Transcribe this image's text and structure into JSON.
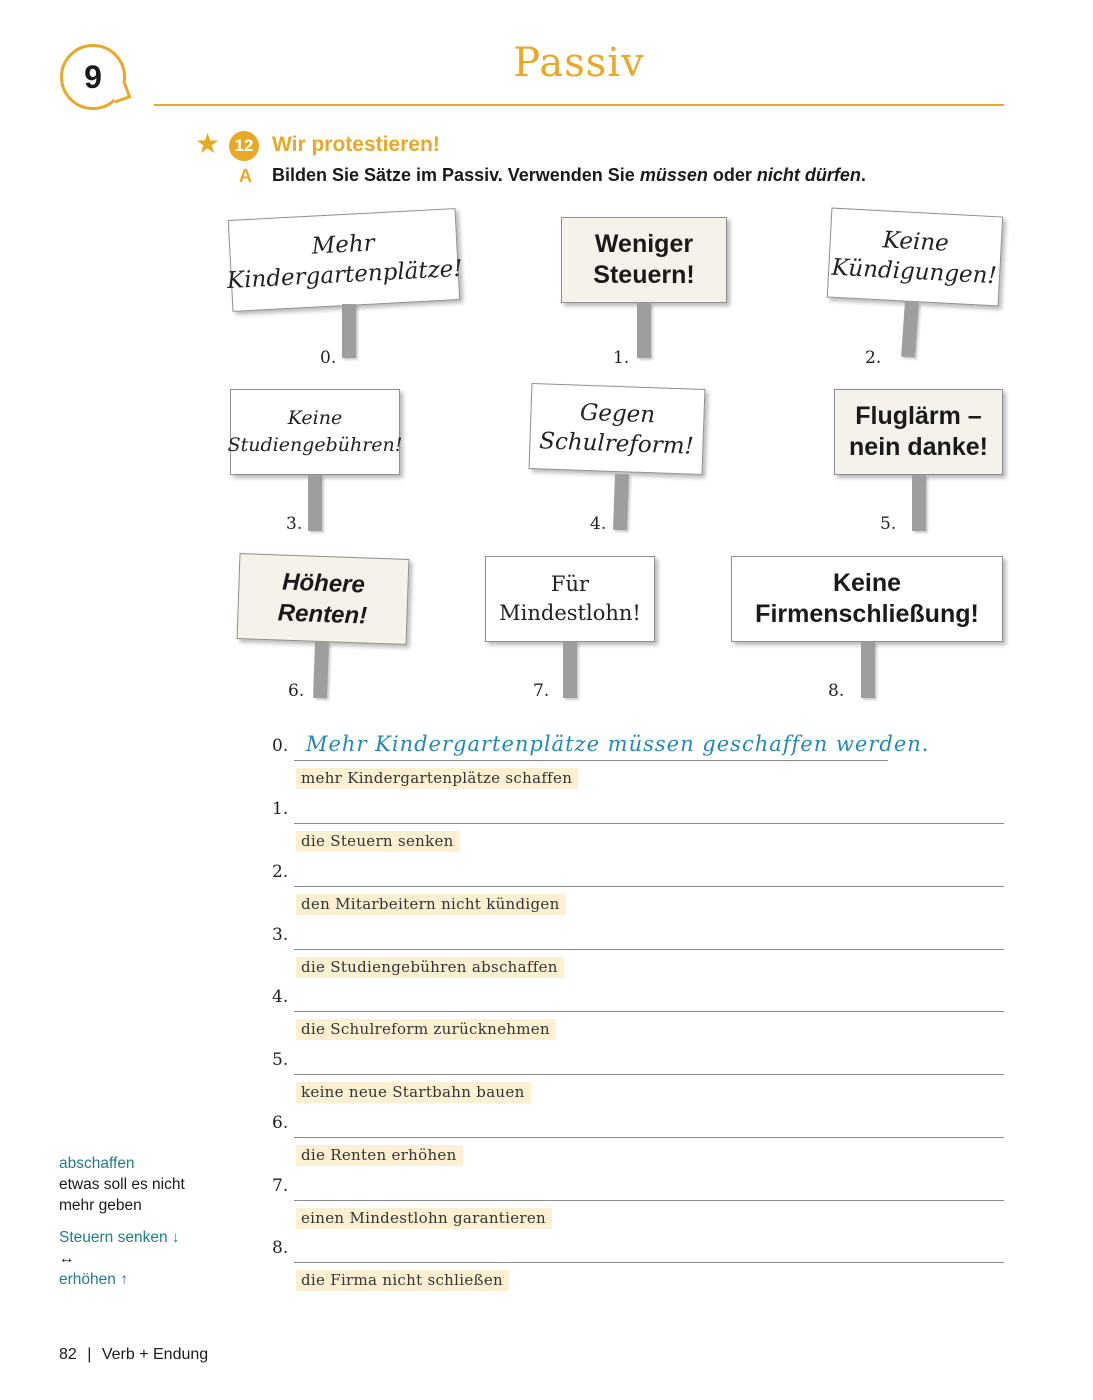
{
  "header": {
    "chapter_number": "9",
    "title": "Passiv"
  },
  "exercise": {
    "number": "12",
    "title": "Wir protestieren!",
    "task_letter": "A",
    "instruction_start": "Bilden Sie Sätze im Passiv. Verwenden Sie ",
    "instruction_em1": "müssen",
    "instruction_mid": " oder ",
    "instruction_em2": "nicht dürfen",
    "instruction_end": "."
  },
  "signs": [
    {
      "number": "0.",
      "line1": "Mehr",
      "line2": "Kindergartenplätze!"
    },
    {
      "number": "1.",
      "line1": "Weniger",
      "line2": "Steuern!"
    },
    {
      "number": "2.",
      "line1": "Keine",
      "line2": "Kündigungen!"
    },
    {
      "number": "3.",
      "line1": "Keine",
      "line2": "Studiengebühren!"
    },
    {
      "number": "4.",
      "line1": "Gegen",
      "line2": "Schulreform!"
    },
    {
      "number": "5.",
      "line1": "Fluglärm –",
      "line2": "nein danke!"
    },
    {
      "number": "6.",
      "line1": "Höhere",
      "line2": "Renten!"
    },
    {
      "number": "7.",
      "line1": "Für",
      "line2": "Mindestlohn!"
    },
    {
      "number": "8.",
      "line1": "Keine",
      "line2": "Firmenschließung!"
    }
  ],
  "answers": [
    {
      "number": "0.",
      "answer": "Mehr Kindergartenplätze müssen geschaffen werden.",
      "hint": "mehr Kindergartenplätze schaffen"
    },
    {
      "number": "1.",
      "answer": "",
      "hint": "die Steuern senken"
    },
    {
      "number": "2.",
      "answer": "",
      "hint": "den Mitarbeitern nicht kündigen"
    },
    {
      "number": "3.",
      "answer": "",
      "hint": "die Studiengebühren abschaffen"
    },
    {
      "number": "4.",
      "answer": "",
      "hint": "die Schulreform zurücknehmen"
    },
    {
      "number": "5.",
      "answer": "",
      "hint": "keine neue Startbahn bauen"
    },
    {
      "number": "6.",
      "answer": "",
      "hint": "die Renten erhöhen"
    },
    {
      "number": "7.",
      "answer": "",
      "hint": "einen Mindestlohn garantieren"
    },
    {
      "number": "8.",
      "answer": "",
      "hint": "die Firma nicht schließen"
    }
  ],
  "margin": {
    "term1": "abschaffen",
    "def1_line1": "etwas soll es nicht",
    "def1_line2": "mehr geben",
    "term2": "Steuern senken ↓",
    "arrow": "↔",
    "term3": "erhöhen ↑"
  },
  "footer": {
    "page_number": "82",
    "separator": "|",
    "book_title": "Verb + Endung"
  },
  "colors": {
    "accent": "#e9a825",
    "answer_blue": "#2488b3",
    "margin_teal": "#1f7e8c",
    "hint_bg": "#fdf0d2"
  }
}
